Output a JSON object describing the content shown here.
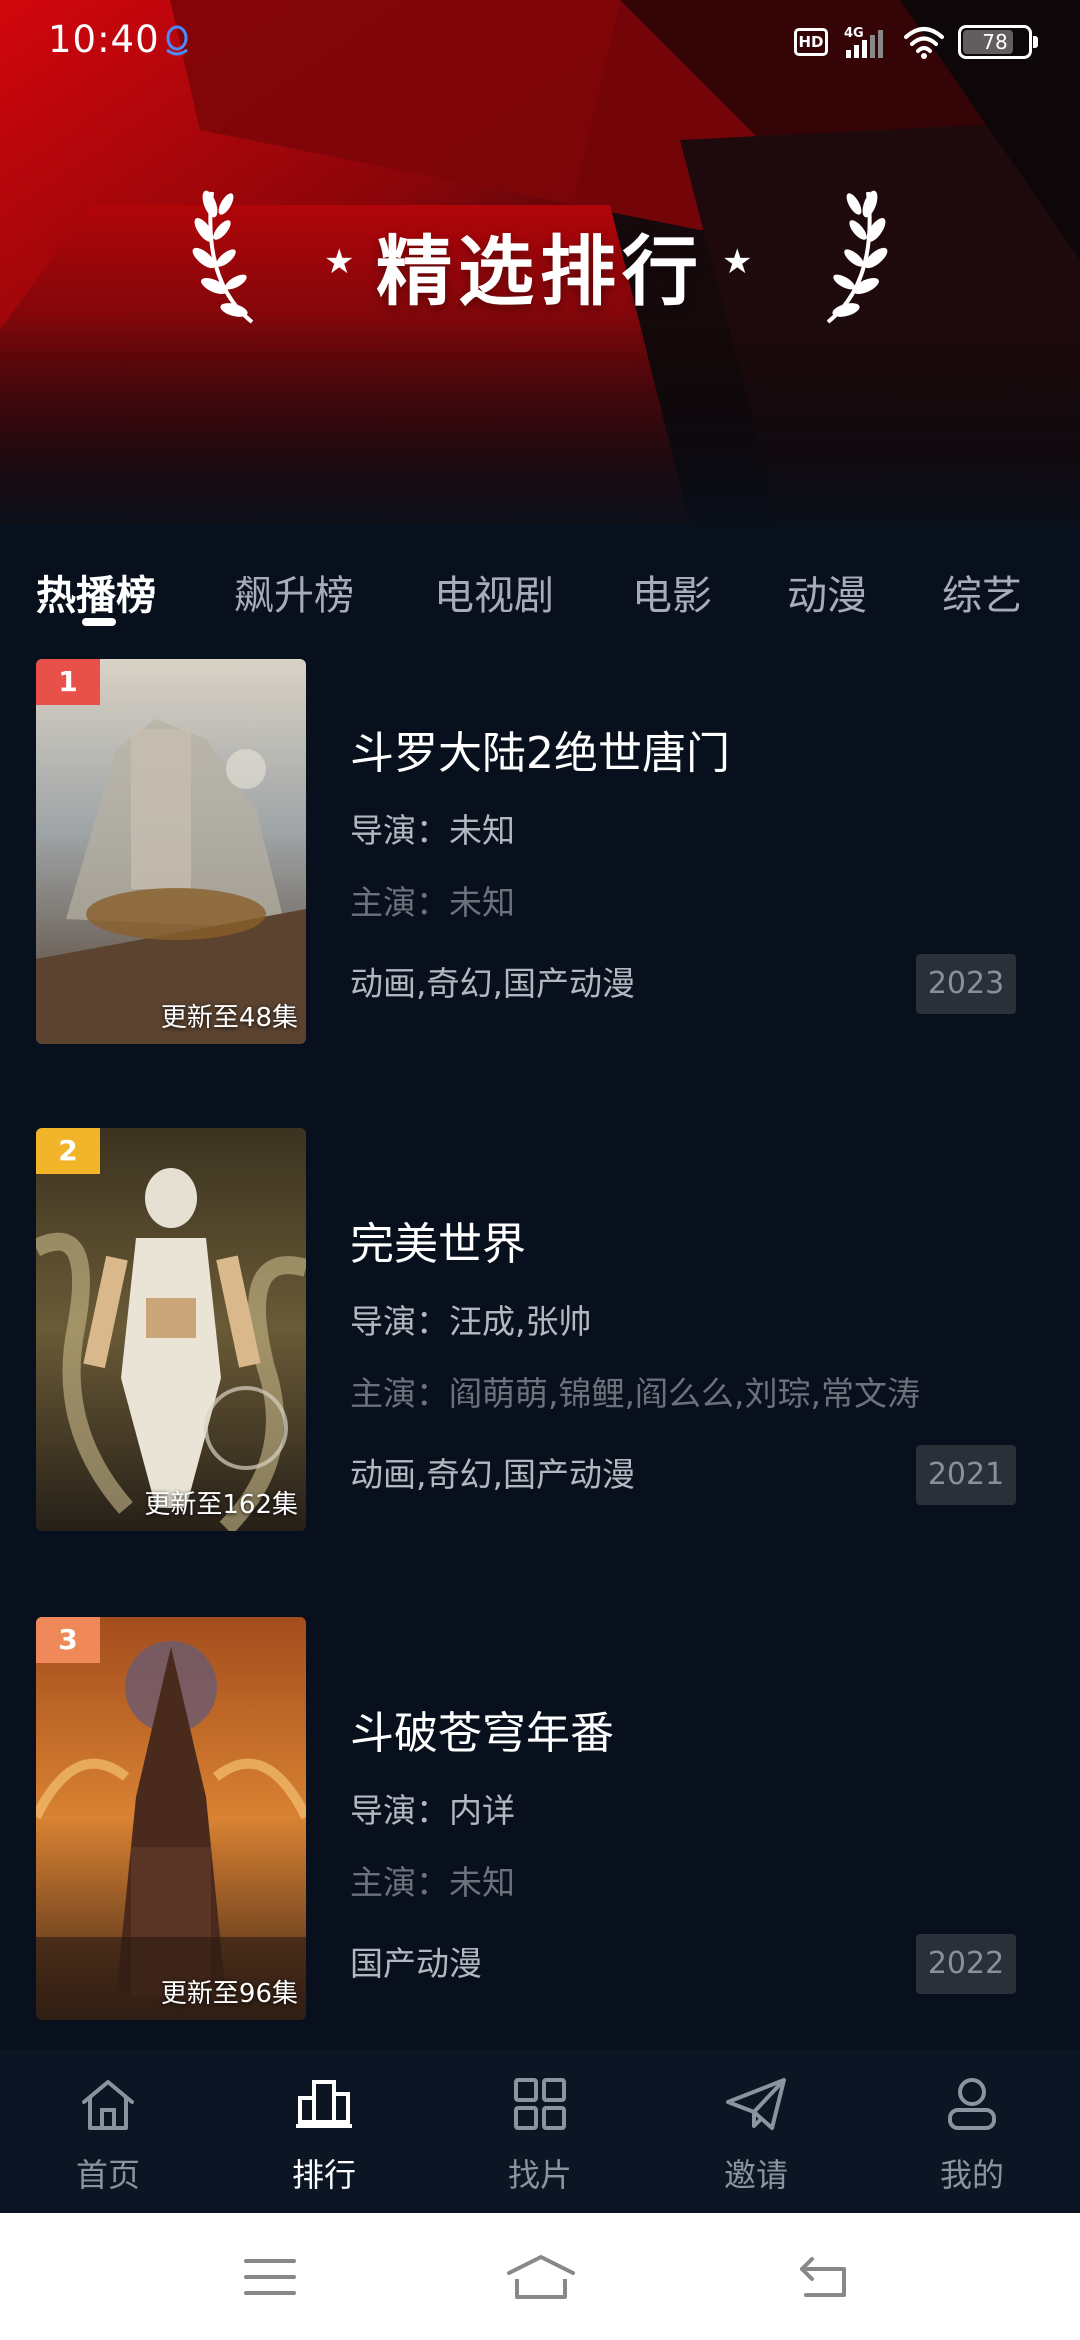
{
  "status_bar": {
    "time": "10:40",
    "hd": "HD",
    "network": "4G",
    "battery": "78",
    "battery_level": 0.78
  },
  "banner": {
    "title": "精选排行"
  },
  "tabs": [
    {
      "label": "热播榜",
      "active": true
    },
    {
      "label": "飙升榜",
      "active": false
    },
    {
      "label": "电视剧",
      "active": false
    },
    {
      "label": "电影",
      "active": false
    },
    {
      "label": "动漫",
      "active": false
    },
    {
      "label": "综艺",
      "active": false
    }
  ],
  "items": [
    {
      "rank": "1",
      "rank_color": "#e8514a",
      "title": "斗罗大陆2绝世唐门",
      "director": "导演：未知",
      "cast": "主演：未知",
      "genre": "动画,奇幻,国产动漫",
      "year": "2023",
      "update": "更新至48集"
    },
    {
      "rank": "2",
      "rank_color": "#f2b52a",
      "title": "完美世界",
      "director": "导演：汪成,张帅",
      "cast": "主演：阎萌萌,锦鲤,阎么么,刘琮,常文涛",
      "genre": "动画,奇幻,国产动漫",
      "year": "2021",
      "update": "更新至162集"
    },
    {
      "rank": "3",
      "rank_color": "#f0895a",
      "title": "斗破苍穹年番",
      "director": "导演：内详",
      "cast": "主演：未知",
      "genre": "国产动漫",
      "year": "2022",
      "update": "更新至96集"
    }
  ],
  "bottom_nav": [
    {
      "label": "首页",
      "icon": "home-icon",
      "active": false
    },
    {
      "label": "排行",
      "icon": "ranking-icon",
      "active": true
    },
    {
      "label": "找片",
      "icon": "grid-icon",
      "active": false
    },
    {
      "label": "邀请",
      "icon": "paper-plane-icon",
      "active": false
    },
    {
      "label": "我的",
      "icon": "user-icon",
      "active": false
    }
  ],
  "system_nav": [
    "menu-icon",
    "home-outline-icon",
    "back-icon"
  ]
}
